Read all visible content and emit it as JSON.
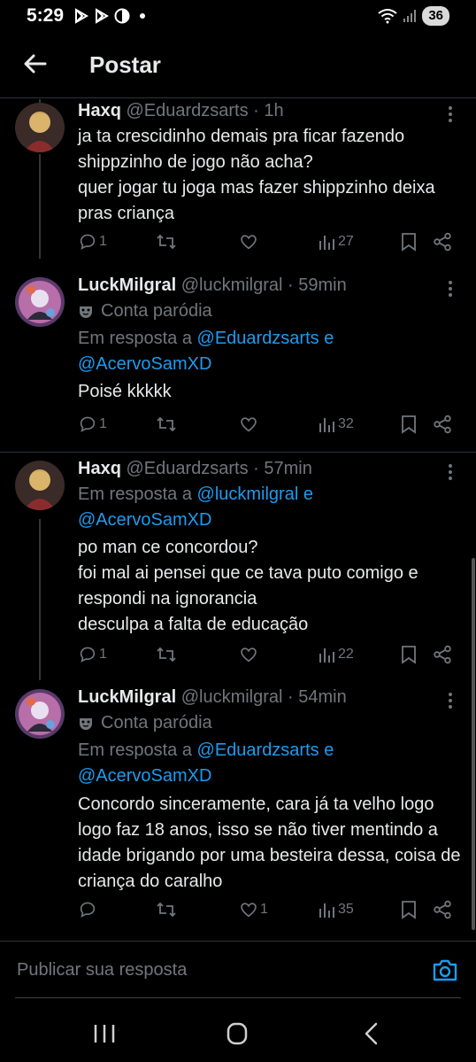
{
  "status_bar": {
    "time": "5:29",
    "battery": "36"
  },
  "header": {
    "title": "Postar"
  },
  "tweets": [
    {
      "name": "Haxq",
      "meta": "@Eduardzsarts · 1h",
      "text": "ja ta crescidinho demais pra ficar fazendo shippzinho de jogo não acha?\nquer jogar tu joga mas fazer shippzinho deixa pras criança",
      "replies": "1",
      "likes": "",
      "views": "27"
    },
    {
      "name": "LuckMilgral",
      "meta": "@luckmilgral · 59min",
      "parody": "Conta paródia",
      "reply_prefix": "Em resposta a ",
      "reply_user1": "@Eduardzsarts",
      "reply_and": " e",
      "reply_user2": "@AcervoSamXD",
      "text": "Poisé kkkkk",
      "replies": "1",
      "likes": "",
      "views": "32"
    },
    {
      "name": "Haxq",
      "meta": "@Eduardzsarts · 57min",
      "reply_prefix": "Em resposta a ",
      "reply_user1": "@luckmilgral",
      "reply_and": " e",
      "reply_user2": "@AcervoSamXD",
      "text": "po man ce concordou?\nfoi mal ai pensei que ce tava puto comigo e respondi na ignorancia\ndesculpa a falta de educação",
      "replies": "1",
      "likes": "",
      "views": "22"
    },
    {
      "name": "LuckMilgral",
      "meta": "@luckmilgral · 54min",
      "parody": "Conta paródia",
      "reply_prefix": "Em resposta a ",
      "reply_user1": "@Eduardzsarts",
      "reply_and": " e",
      "reply_user2": "@AcervoSamXD",
      "text": "Concordo sinceramente, cara já ta velho logo logo faz 18 anos, isso se não tiver mentindo a idade brigando por uma besteira dessa, coisa de criança do caralho",
      "replies": "",
      "likes": "1",
      "views": "35"
    }
  ],
  "composer": {
    "placeholder": "Publicar sua resposta"
  },
  "colors": {
    "link": "#1d9bf0",
    "muted": "#71767b",
    "text": "#e7e9ea",
    "background": "#000000"
  },
  "icons": [
    "back-arrow-icon",
    "reply-icon",
    "retweet-icon",
    "like-icon",
    "views-icon",
    "bookmark-icon",
    "share-icon",
    "more-icon",
    "mask-icon",
    "camera-icon",
    "recents-icon",
    "home-icon",
    "back-nav-icon"
  ]
}
